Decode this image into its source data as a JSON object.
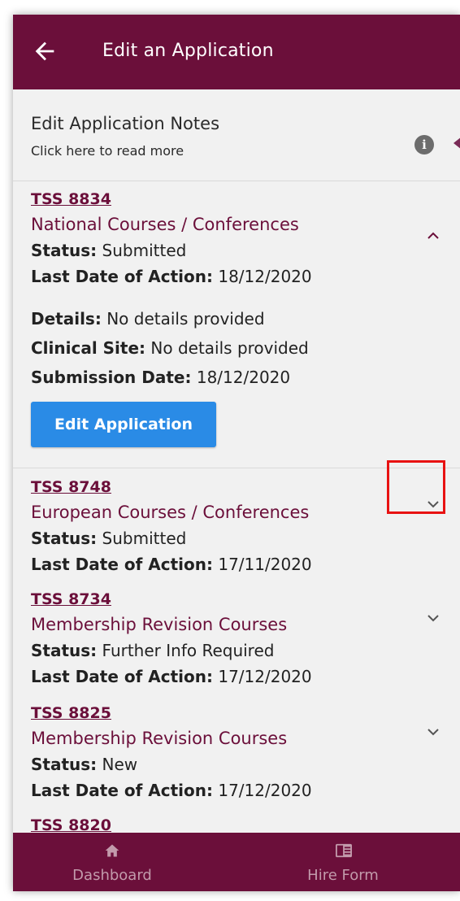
{
  "header": {
    "title": "Edit an Application",
    "back_icon": "arrow-left-icon"
  },
  "notes": {
    "title": "Edit Application Notes",
    "subtitle": "Click here to read more",
    "icon": "info-icon"
  },
  "applications": [
    {
      "code": "TSS 8834",
      "type": "National Courses / Conferences",
      "status_label": "Status:",
      "status": " Submitted",
      "date_label": "Last Date of Action:",
      "date": " 18/12/2020",
      "expanded": true,
      "details_label": "Details:",
      "details": " No details provided",
      "site_label": "Clinical Site:",
      "site": " No details provided",
      "submission_label": "Submission Date:",
      "submission": " 18/12/2020",
      "button": "Edit Application"
    },
    {
      "code": "TSS 8748",
      "type": "European Courses / Conferences",
      "status_label": "Status:",
      "status": " Submitted",
      "date_label": "Last Date of Action:",
      "date": " 17/11/2020",
      "expanded": false
    },
    {
      "code": "TSS 8734",
      "type": "Membership Revision Courses",
      "status_label": "Status:",
      "status": " Further Info Required",
      "date_label": "Last Date of Action:",
      "date": " 17/12/2020",
      "expanded": false
    },
    {
      "code": "TSS 8825",
      "type": "Membership Revision Courses",
      "status_label": "Status:",
      "status": " New",
      "date_label": "Last Date of Action:",
      "date": " 17/12/2020",
      "expanded": false
    },
    {
      "code": "TSS 8820"
    }
  ],
  "bottom_nav": [
    {
      "label": "Dashboard",
      "icon": "home-icon"
    },
    {
      "label": "Hire Form",
      "icon": "form-icon"
    }
  ],
  "colors": {
    "brand": "#6b0f3a",
    "button": "#2a8be6",
    "highlight": "#e81212"
  }
}
